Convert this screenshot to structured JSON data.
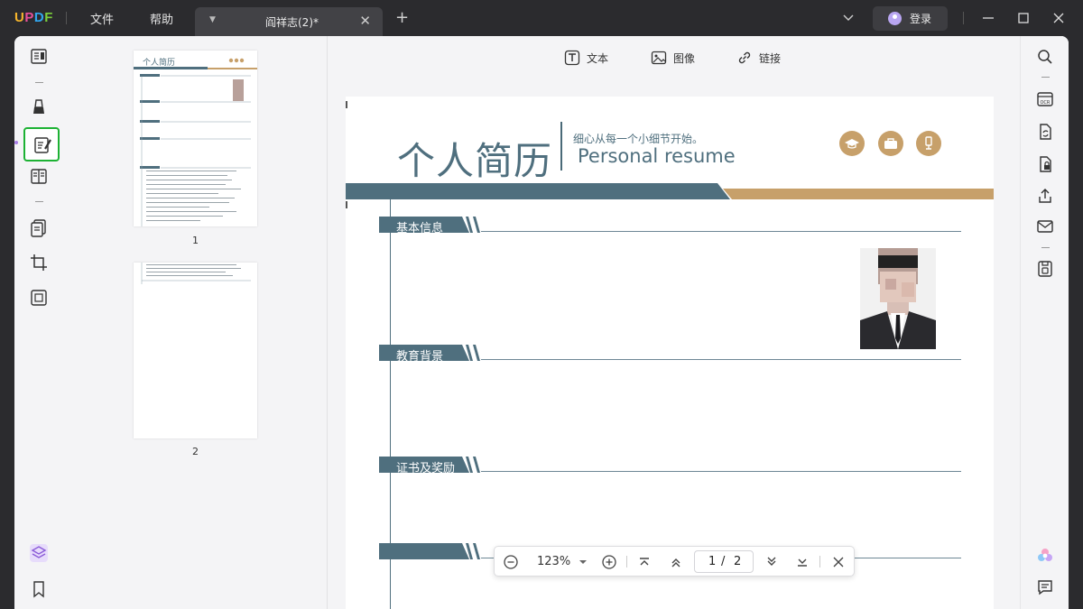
{
  "app": {
    "logo_letters": [
      "U",
      "P",
      "D",
      "F"
    ],
    "logo_colors": [
      "#f6b52c",
      "#e8509a",
      "#31a6f0",
      "#7bcf3b"
    ],
    "menu": {
      "file": "文件",
      "help": "帮助"
    },
    "tab": {
      "title": "阎祥志(2)*"
    },
    "login_label": "登录"
  },
  "edit_toolbar": {
    "text": "文本",
    "image": "图像",
    "link": "链接"
  },
  "thumbnails": [
    {
      "page": "1"
    },
    {
      "page": "2"
    }
  ],
  "thumb_mini": {
    "title_cn": "个人简历"
  },
  "resume": {
    "title_cn": "个人简历",
    "slogan": "细心从每一个小细节开始。",
    "title_en": "Personal  resume",
    "sections": [
      "基本信息",
      "教育背景",
      "证书及奖励",
      ""
    ]
  },
  "zoom": {
    "level": "123%",
    "current_page": "1",
    "separator": "/",
    "total_pages": "2"
  },
  "colors": {
    "accent_green": "#1db234",
    "resume_blue": "#4f6f7e",
    "resume_gold": "#c7a06a"
  }
}
